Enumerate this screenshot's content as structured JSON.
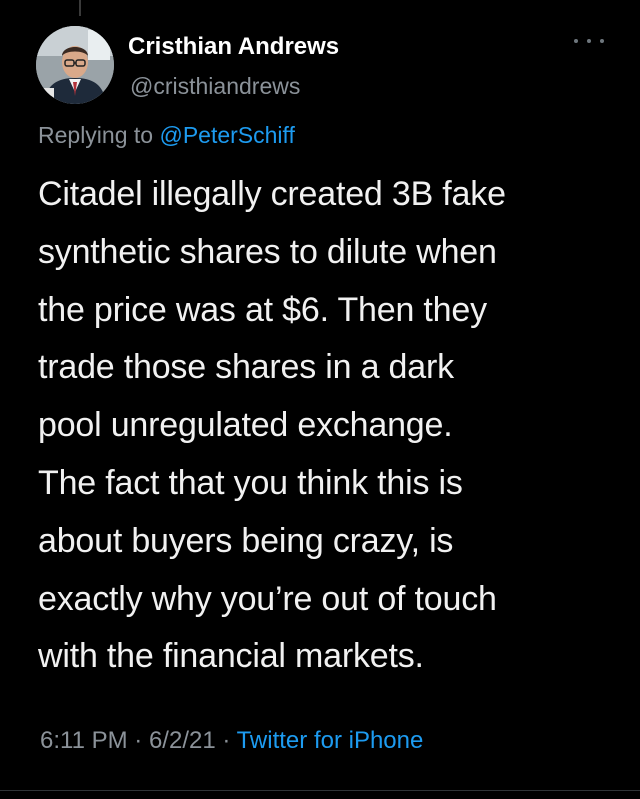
{
  "author": {
    "display_name": "Cristhian Andrews",
    "handle": "@cristhiandrews",
    "avatar_icon": "profile-photo"
  },
  "reply": {
    "prefix": "Replying to",
    "mention": "@PeterSchiff"
  },
  "tweet": {
    "lines": [
      "Citadel illegally created 3B fake",
      "synthetic shares to dilute when",
      "the price was at $6. Then they",
      "trade those shares in a dark",
      "pool unregulated exchange.",
      "The fact that you think this is",
      "about buyers being crazy, is",
      "exactly why you’re out of touch",
      "with the financial markets."
    ]
  },
  "meta": {
    "time": "6:11 PM",
    "separator": "·",
    "date": "6/2/21",
    "source": "Twitter for iPhone"
  },
  "more_icon": "more-dots-icon",
  "colors": {
    "background": "#000000",
    "text": "#f1f1f1",
    "secondary": "#8b9299",
    "link": "#1d9bf0"
  }
}
